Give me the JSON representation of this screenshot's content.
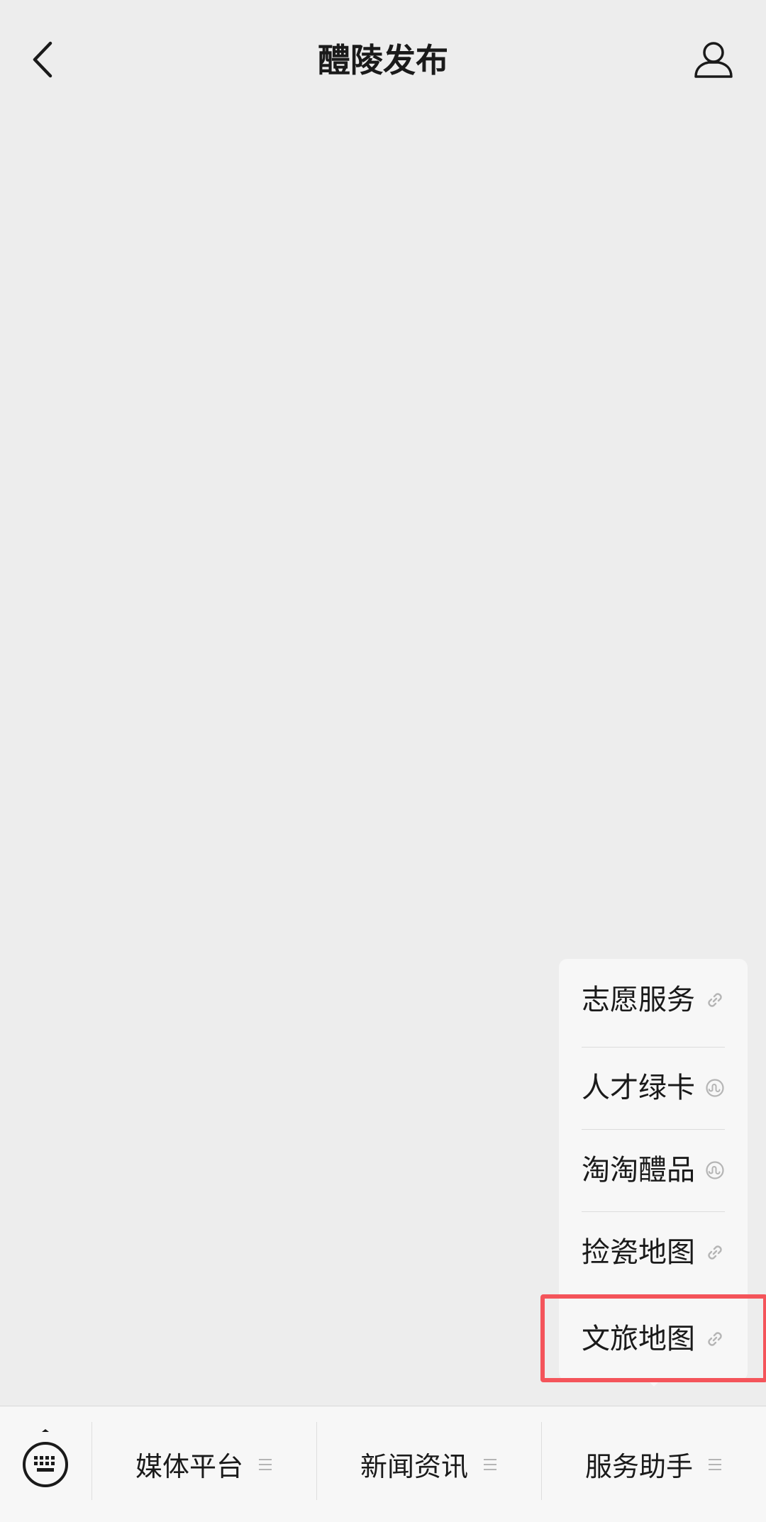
{
  "header": {
    "title": "醴陵发布",
    "back_icon": "chevron-left-icon",
    "profile_icon": "user-icon"
  },
  "submenu": {
    "items": [
      {
        "label": "志愿服务",
        "icon": "link-icon"
      },
      {
        "label": "人才绿卡",
        "icon": "mini-program-icon"
      },
      {
        "label": "淘淘醴品",
        "icon": "mini-program-icon"
      },
      {
        "label": "捡瓷地图",
        "icon": "link-icon"
      },
      {
        "label": "文旅地图",
        "icon": "link-icon"
      }
    ],
    "highlighted_index": 4,
    "highlight_color": "#f4545a"
  },
  "bottom_bar": {
    "keyboard_icon": "keyboard-icon",
    "menus": [
      {
        "label": "媒体平台",
        "icon": "menu-lines-icon"
      },
      {
        "label": "新闻资讯",
        "icon": "menu-lines-icon"
      },
      {
        "label": "服务助手",
        "icon": "menu-lines-icon"
      }
    ]
  },
  "colors": {
    "background": "#ededed",
    "panel": "#f7f7f7",
    "text": "#1a1a1a"
  }
}
